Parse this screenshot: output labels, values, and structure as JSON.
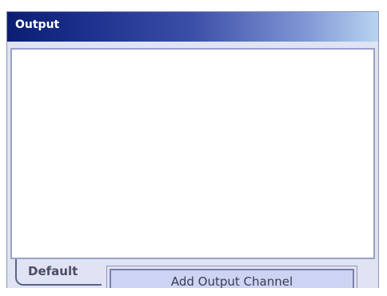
{
  "panel": {
    "title": "Output"
  },
  "tabs": [
    {
      "label": "Default",
      "selected": true
    },
    {
      "label": "Add Output Channel",
      "selected": false
    }
  ]
}
